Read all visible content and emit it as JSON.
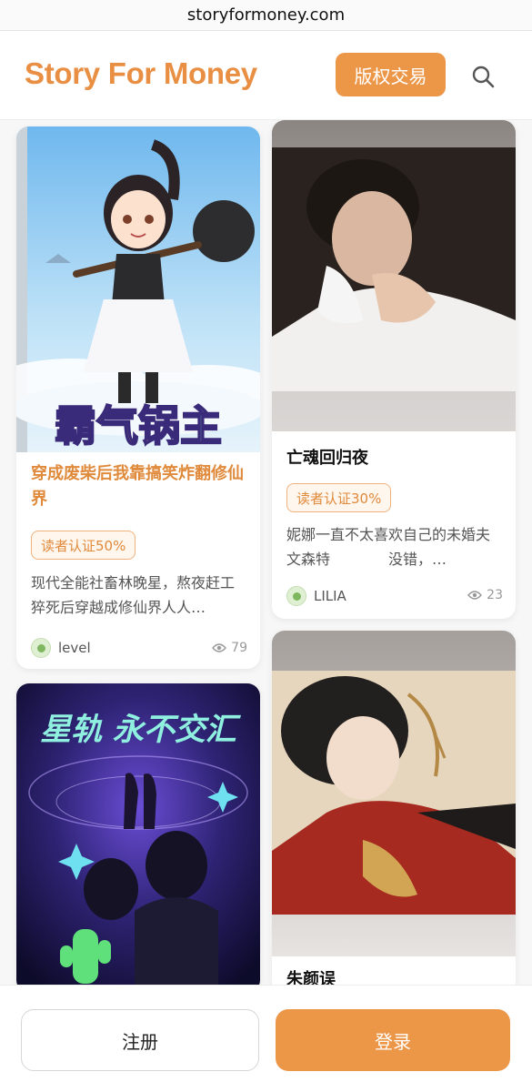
{
  "browser": {
    "url": "storyformoney.com"
  },
  "header": {
    "logo": "Story For Money",
    "trade_button": "版权交易",
    "search_icon": "search-icon"
  },
  "stories": [
    {
      "title": "穿成废柴后我靠搞笑炸翻修仙界",
      "cover_text": "霸气锅主",
      "tag": "读者认证50%",
      "description": "现代全能社畜林晚星，熬夜赶工猝死后穿越成修仙界人人…",
      "author": "level",
      "views": "79"
    },
    {
      "title": "亡魂回归夜",
      "tag": "读者认证30%",
      "description": "妮娜一直不太喜欢自己的未婚夫文森特　　　　没错，…",
      "author": "LILIA",
      "views": "23"
    },
    {
      "title": "",
      "cover_text": "星轨 永不交汇"
    },
    {
      "title": "朱颜误"
    }
  ],
  "bottom": {
    "register": "注册",
    "login": "登录"
  },
  "colors": {
    "accent": "#ec9648",
    "brand": "#e98f44"
  }
}
